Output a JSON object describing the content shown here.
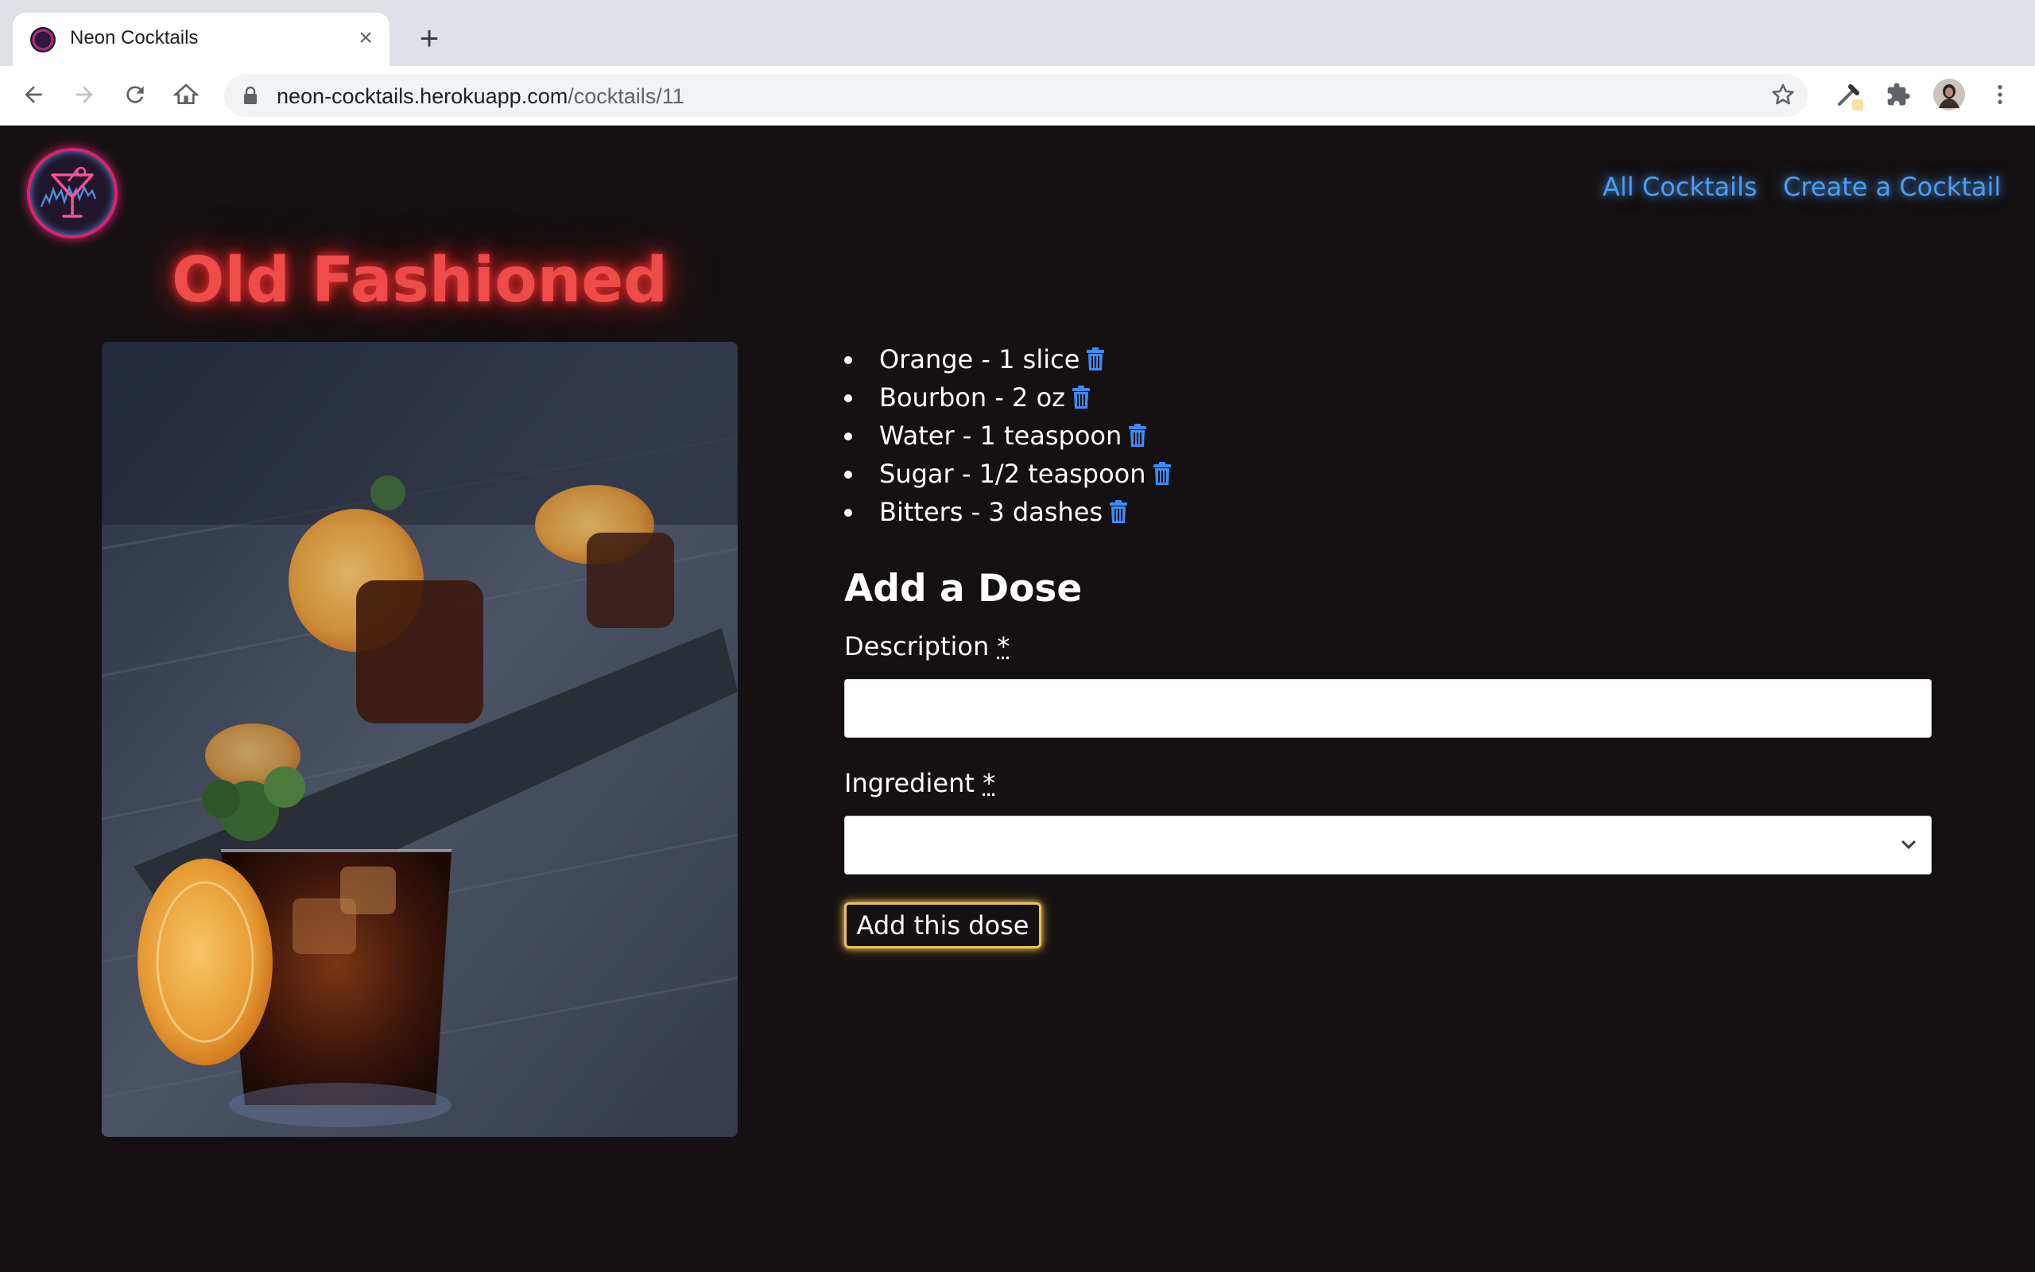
{
  "browser": {
    "tab_title": "Neon Cocktails",
    "new_tab_symbol": "+",
    "close_symbol": "×",
    "url_host": "neon-cocktails.herokuapp.com",
    "url_path": "/cocktails/11"
  },
  "nav": {
    "all_cocktails": "All Cocktails",
    "create_cocktail": "Create a Cocktail"
  },
  "cocktail": {
    "name": "Old Fashioned"
  },
  "doses": [
    {
      "text": "Orange - 1 slice"
    },
    {
      "text": "Bourbon - 2 oz"
    },
    {
      "text": "Water - 1 teaspoon"
    },
    {
      "text": "Sugar - 1/2 teaspoon"
    },
    {
      "text": "Bitters - 3 dashes"
    }
  ],
  "form": {
    "title": "Add a Dose",
    "description_label": "Description",
    "ingredient_label": "Ingredient",
    "required_mark": "*",
    "description_value": "",
    "ingredient_value": "",
    "submit_label": "Add this dose"
  },
  "colors": {
    "page_bg": "#151112",
    "neon_red": "#ee4b4b",
    "link_blue": "#4d9cf0",
    "trash_blue": "#3d8bf5",
    "button_glow": "#e7c15a"
  },
  "icons": {
    "back": "back-arrow-icon",
    "forward": "forward-arrow-icon",
    "reload": "reload-icon",
    "home": "home-icon",
    "lock": "lock-icon",
    "star": "star-icon",
    "eyedropper": "eyedropper-extension-icon",
    "extensions": "puzzle-icon",
    "profile": "profile-avatar",
    "menu": "kebab-menu-icon",
    "delete": "trash-icon"
  }
}
